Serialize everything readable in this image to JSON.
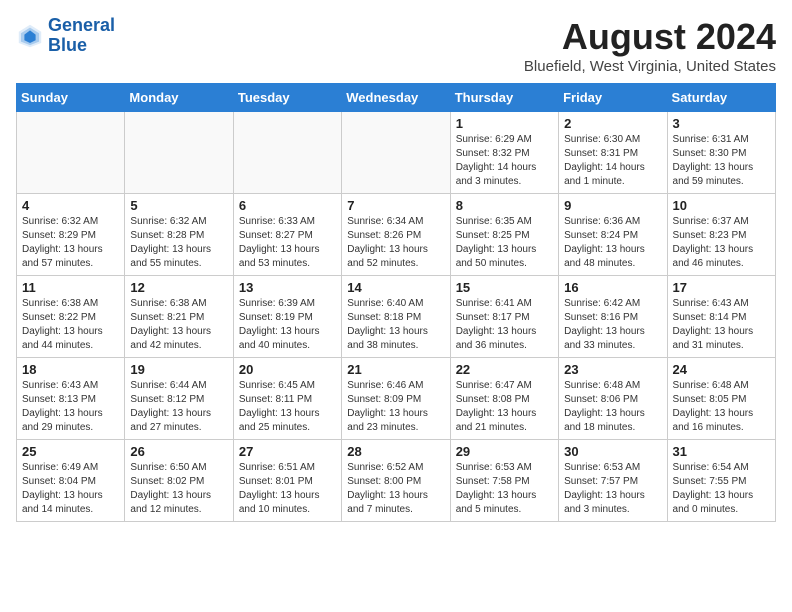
{
  "header": {
    "logo_line1": "General",
    "logo_line2": "Blue",
    "month_year": "August 2024",
    "location": "Bluefield, West Virginia, United States"
  },
  "weekdays": [
    "Sunday",
    "Monday",
    "Tuesday",
    "Wednesday",
    "Thursday",
    "Friday",
    "Saturday"
  ],
  "weeks": [
    [
      {
        "day": "",
        "info": ""
      },
      {
        "day": "",
        "info": ""
      },
      {
        "day": "",
        "info": ""
      },
      {
        "day": "",
        "info": ""
      },
      {
        "day": "1",
        "info": "Sunrise: 6:29 AM\nSunset: 8:32 PM\nDaylight: 14 hours\nand 3 minutes."
      },
      {
        "day": "2",
        "info": "Sunrise: 6:30 AM\nSunset: 8:31 PM\nDaylight: 14 hours\nand 1 minute."
      },
      {
        "day": "3",
        "info": "Sunrise: 6:31 AM\nSunset: 8:30 PM\nDaylight: 13 hours\nand 59 minutes."
      }
    ],
    [
      {
        "day": "4",
        "info": "Sunrise: 6:32 AM\nSunset: 8:29 PM\nDaylight: 13 hours\nand 57 minutes."
      },
      {
        "day": "5",
        "info": "Sunrise: 6:32 AM\nSunset: 8:28 PM\nDaylight: 13 hours\nand 55 minutes."
      },
      {
        "day": "6",
        "info": "Sunrise: 6:33 AM\nSunset: 8:27 PM\nDaylight: 13 hours\nand 53 minutes."
      },
      {
        "day": "7",
        "info": "Sunrise: 6:34 AM\nSunset: 8:26 PM\nDaylight: 13 hours\nand 52 minutes."
      },
      {
        "day": "8",
        "info": "Sunrise: 6:35 AM\nSunset: 8:25 PM\nDaylight: 13 hours\nand 50 minutes."
      },
      {
        "day": "9",
        "info": "Sunrise: 6:36 AM\nSunset: 8:24 PM\nDaylight: 13 hours\nand 48 minutes."
      },
      {
        "day": "10",
        "info": "Sunrise: 6:37 AM\nSunset: 8:23 PM\nDaylight: 13 hours\nand 46 minutes."
      }
    ],
    [
      {
        "day": "11",
        "info": "Sunrise: 6:38 AM\nSunset: 8:22 PM\nDaylight: 13 hours\nand 44 minutes."
      },
      {
        "day": "12",
        "info": "Sunrise: 6:38 AM\nSunset: 8:21 PM\nDaylight: 13 hours\nand 42 minutes."
      },
      {
        "day": "13",
        "info": "Sunrise: 6:39 AM\nSunset: 8:19 PM\nDaylight: 13 hours\nand 40 minutes."
      },
      {
        "day": "14",
        "info": "Sunrise: 6:40 AM\nSunset: 8:18 PM\nDaylight: 13 hours\nand 38 minutes."
      },
      {
        "day": "15",
        "info": "Sunrise: 6:41 AM\nSunset: 8:17 PM\nDaylight: 13 hours\nand 36 minutes."
      },
      {
        "day": "16",
        "info": "Sunrise: 6:42 AM\nSunset: 8:16 PM\nDaylight: 13 hours\nand 33 minutes."
      },
      {
        "day": "17",
        "info": "Sunrise: 6:43 AM\nSunset: 8:14 PM\nDaylight: 13 hours\nand 31 minutes."
      }
    ],
    [
      {
        "day": "18",
        "info": "Sunrise: 6:43 AM\nSunset: 8:13 PM\nDaylight: 13 hours\nand 29 minutes."
      },
      {
        "day": "19",
        "info": "Sunrise: 6:44 AM\nSunset: 8:12 PM\nDaylight: 13 hours\nand 27 minutes."
      },
      {
        "day": "20",
        "info": "Sunrise: 6:45 AM\nSunset: 8:11 PM\nDaylight: 13 hours\nand 25 minutes."
      },
      {
        "day": "21",
        "info": "Sunrise: 6:46 AM\nSunset: 8:09 PM\nDaylight: 13 hours\nand 23 minutes."
      },
      {
        "day": "22",
        "info": "Sunrise: 6:47 AM\nSunset: 8:08 PM\nDaylight: 13 hours\nand 21 minutes."
      },
      {
        "day": "23",
        "info": "Sunrise: 6:48 AM\nSunset: 8:06 PM\nDaylight: 13 hours\nand 18 minutes."
      },
      {
        "day": "24",
        "info": "Sunrise: 6:48 AM\nSunset: 8:05 PM\nDaylight: 13 hours\nand 16 minutes."
      }
    ],
    [
      {
        "day": "25",
        "info": "Sunrise: 6:49 AM\nSunset: 8:04 PM\nDaylight: 13 hours\nand 14 minutes."
      },
      {
        "day": "26",
        "info": "Sunrise: 6:50 AM\nSunset: 8:02 PM\nDaylight: 13 hours\nand 12 minutes."
      },
      {
        "day": "27",
        "info": "Sunrise: 6:51 AM\nSunset: 8:01 PM\nDaylight: 13 hours\nand 10 minutes."
      },
      {
        "day": "28",
        "info": "Sunrise: 6:52 AM\nSunset: 8:00 PM\nDaylight: 13 hours\nand 7 minutes."
      },
      {
        "day": "29",
        "info": "Sunrise: 6:53 AM\nSunset: 7:58 PM\nDaylight: 13 hours\nand 5 minutes."
      },
      {
        "day": "30",
        "info": "Sunrise: 6:53 AM\nSunset: 7:57 PM\nDaylight: 13 hours\nand 3 minutes."
      },
      {
        "day": "31",
        "info": "Sunrise: 6:54 AM\nSunset: 7:55 PM\nDaylight: 13 hours\nand 0 minutes."
      }
    ]
  ]
}
